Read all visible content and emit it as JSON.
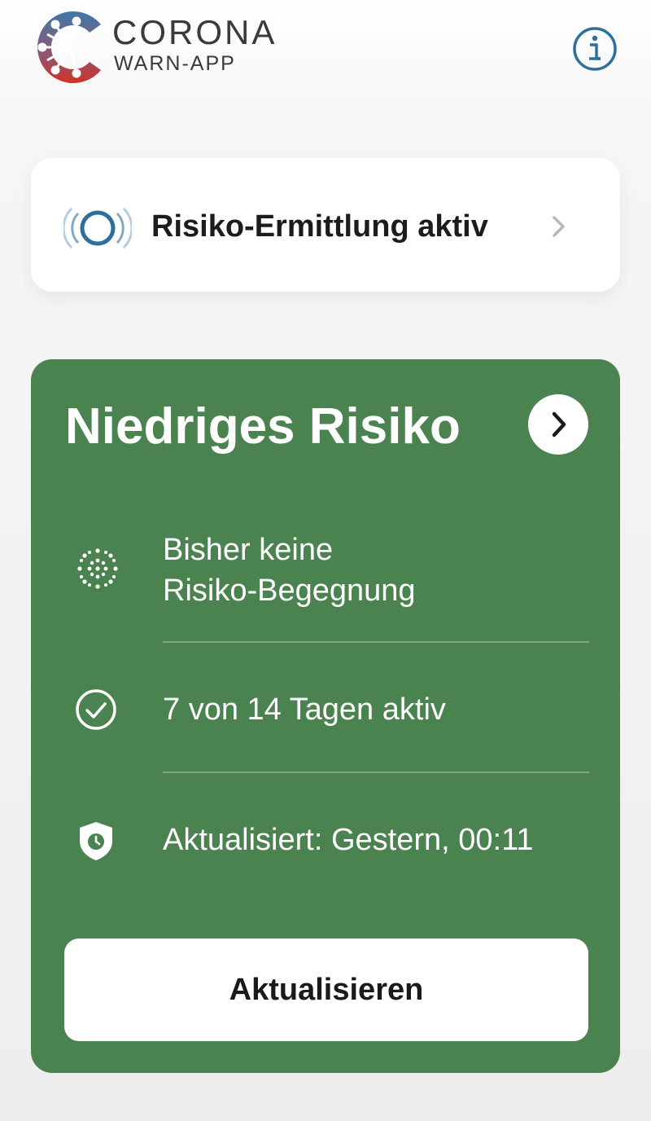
{
  "header": {
    "logo_title": "CORONA",
    "logo_subtitle": "WARN-APP",
    "logo_icon": "corona-virus-logo-icon",
    "info_icon": "info-icon"
  },
  "tracing": {
    "label": "Risiko-Ermittlung aktiv",
    "icon": "exposure-tracing-active-icon",
    "chevron": "chevron-right-icon"
  },
  "risk_card": {
    "title": "Niedriges Risiko",
    "color": "#4a8350",
    "chevron": "chevron-right-icon",
    "rows": [
      {
        "icon": "virus-icon",
        "line1": "Bisher keine",
        "line2": "Risiko-Begegnung"
      },
      {
        "icon": "check-circle-icon",
        "text": "7 von 14 Tagen aktiv"
      },
      {
        "icon": "shield-clock-icon",
        "text": "Aktualisiert: Gestern, 00:11"
      }
    ],
    "button_label": "Aktualisieren"
  },
  "colors": {
    "accent_blue": "#2f6f9c",
    "logo_red": "#c4332b",
    "risk_green": "#4a8350"
  }
}
